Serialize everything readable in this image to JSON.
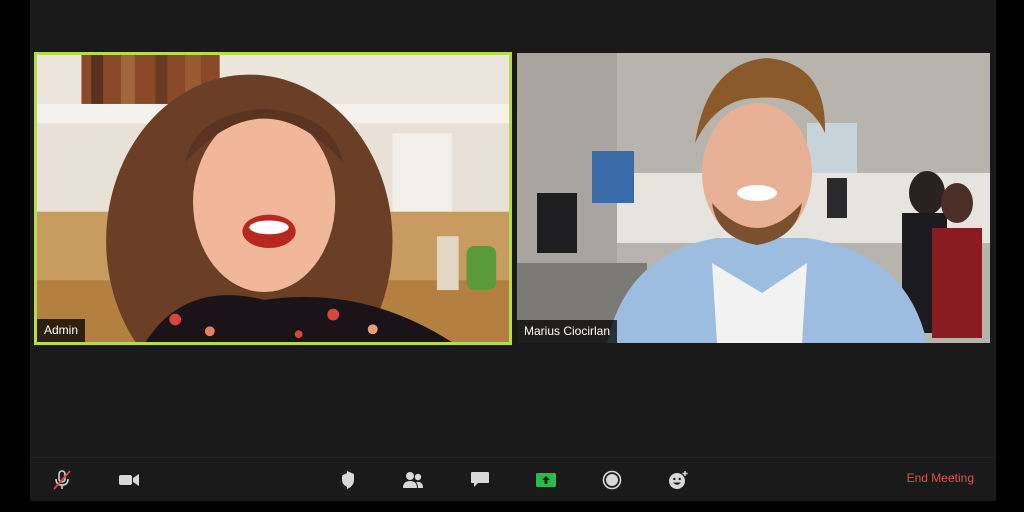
{
  "participants": [
    {
      "name": "Admin",
      "active_speaker": true
    },
    {
      "name": "Marius Ciocirlan",
      "active_speaker": false
    }
  ],
  "toolbar": {
    "mute_icon": "microphone-muted-icon",
    "video_icon": "video-camera-icon",
    "security_icon": "shield-icon",
    "participants_icon": "participants-icon",
    "chat_icon": "chat-bubble-icon",
    "share_icon": "share-screen-icon",
    "record_icon": "record-icon",
    "reactions_icon": "reaction-smiley-icon",
    "end_meeting_label": "End Meeting"
  },
  "colors": {
    "active_border": "#b4dc4c",
    "share_green": "#2db84d",
    "end_meeting_red": "#e1514a",
    "muted_red": "#e04a3a"
  }
}
